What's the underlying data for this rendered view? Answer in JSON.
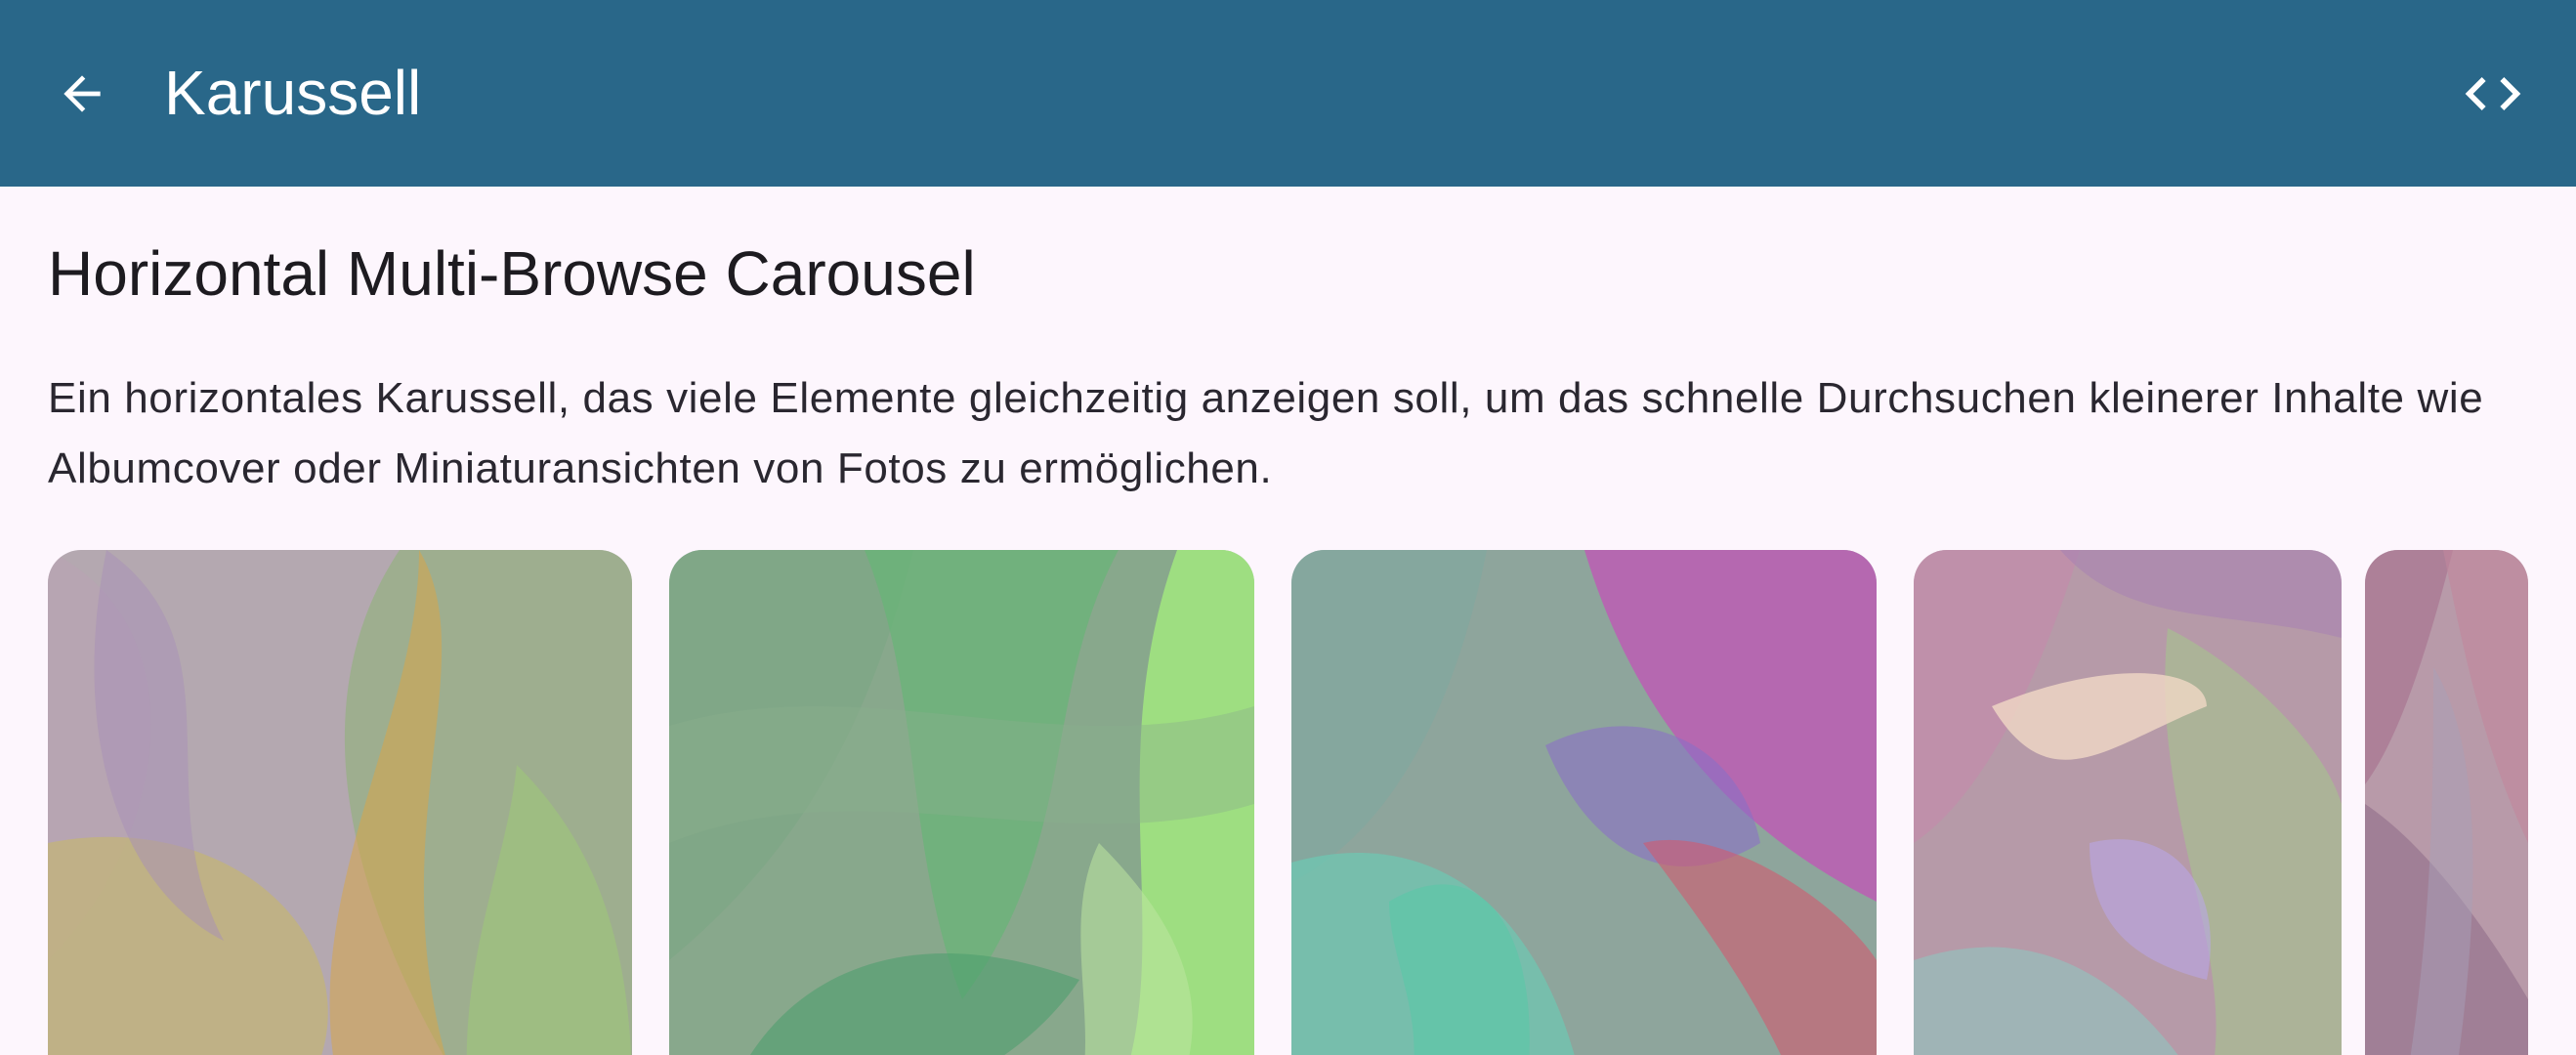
{
  "appbar": {
    "title": "Karussell",
    "back_icon": "arrow-back-icon",
    "code_icon": "code-icon",
    "background": "#296789"
  },
  "section": {
    "title": "Horizontal Multi-Browse Carousel",
    "description": "Ein horizontales Karussell, das viele Elemente gleichzeitig anzeigen soll, um das schnelle Durchsuchen kleinerer Inhalte wie Albumcover oder Miniaturansichten von Fotos zu ermöglichen."
  },
  "carousel": {
    "items": [
      {
        "palette": [
          "#b9a3b4",
          "#8fb37a",
          "#c7b86a",
          "#a78fb7",
          "#d7a64b",
          "#9ec779"
        ]
      },
      {
        "palette": [
          "#7aa684",
          "#63b873",
          "#a5f07d",
          "#8ab08c",
          "#4f9e6e",
          "#bde6a0"
        ]
      },
      {
        "palette": [
          "#7fa9a0",
          "#c64fb9",
          "#6fc7b1",
          "#8b6fc6",
          "#d05a6f",
          "#58c9a8"
        ]
      },
      {
        "palette": [
          "#c58bab",
          "#a4c98a",
          "#a884b2",
          "#f1d8c6",
          "#8fc7bf",
          "#b9a7e6"
        ]
      },
      {
        "palette": [
          "#a56f8d",
          "#c2879c",
          "#8d6a86",
          "#a8a0b8"
        ]
      }
    ]
  }
}
